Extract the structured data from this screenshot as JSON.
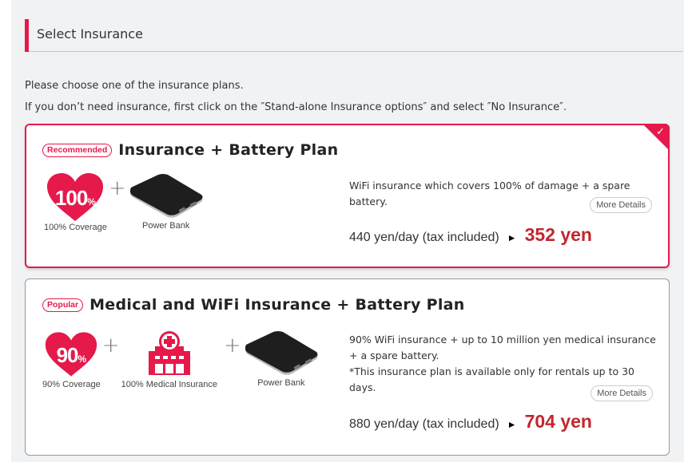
{
  "section": {
    "title": "Select Insurance",
    "accent_color": "#e5194a"
  },
  "intro": {
    "line1": "Please choose one of the insurance plans.",
    "line2": "If you don’t need insurance, first click on the ″Stand-alone Insurance options″ and select ″No Insurance″."
  },
  "plans": [
    {
      "badge": "Recommended",
      "title": "Insurance + Battery Plan",
      "selected": true,
      "check_icon": "checkmark-icon",
      "items": [
        {
          "icon": "heart-100-icon",
          "icon_text": "100",
          "icon_suffix": "%",
          "label": "100% Coverage"
        },
        {
          "icon": "power-bank-icon",
          "label": "Power Bank"
        }
      ],
      "description": "WiFi insurance which covers 100% of damage + a spare battery.",
      "more_details": "More Details",
      "price_base": "440 yen/day (tax included)",
      "arrow": "►",
      "price_final": "352 yen"
    },
    {
      "badge": "Popular",
      "title": "Medical and WiFi Insurance + Battery Plan",
      "selected": false,
      "items": [
        {
          "icon": "heart-90-icon",
          "icon_text": "90",
          "icon_suffix": "%",
          "label": "90% Coverage"
        },
        {
          "icon": "hospital-icon",
          "label": "100% Medical Insurance"
        },
        {
          "icon": "power-bank-icon",
          "label": "Power Bank"
        }
      ],
      "description_line1": "90% WiFi insurance + up to 10 million yen medical insurance + a spare battery.",
      "description_line2": "*This insurance plan is available only for rentals up to 30 days.",
      "more_details": "More Details",
      "price_base": "880 yen/day (tax included)",
      "arrow": "►",
      "price_final": "704 yen"
    }
  ],
  "colors": {
    "brand_red": "#e5194a",
    "price_red": "#c1272d",
    "background": "#f1f2f4"
  }
}
